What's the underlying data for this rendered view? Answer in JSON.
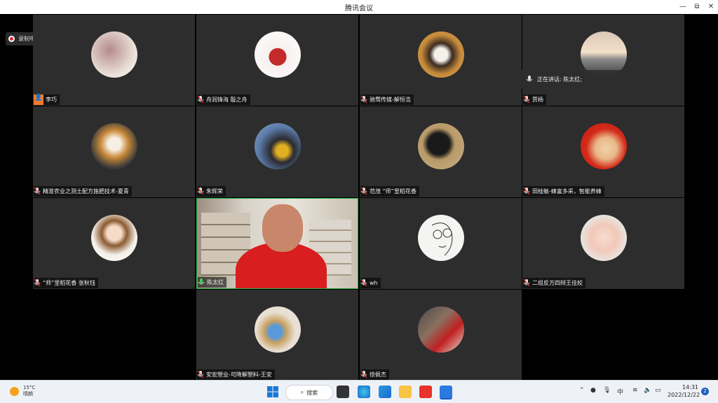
{
  "window": {
    "title": "腾讯会议",
    "minimize": "—",
    "restore": "⧉",
    "close": "✕"
  },
  "recording": {
    "label": "录制中"
  },
  "speaking": {
    "label": "正在讲话: 陈太红;"
  },
  "participants": [
    {
      "name": "李巧"
    },
    {
      "name": "舟润锋海 殷之舟"
    },
    {
      "name": "驰骛传媒-解恒浩"
    },
    {
      "name": "贾杨"
    },
    {
      "name": "精准农业之测土配方施肥技术-夏青"
    },
    {
      "name": "朱辉荣"
    },
    {
      "name": "范茂 “师”里稻花香"
    },
    {
      "name": "田桂敏-蜂富多采，智能养蜂"
    },
    {
      "name": "“师”里稻花香 张秋钰"
    },
    {
      "name": "陈太红"
    },
    {
      "name": "wh"
    },
    {
      "name": "二组反方四辩王佳姣"
    },
    {
      "name": "安宏塑业-可降解塑料-王安"
    },
    {
      "name": "徐佩杰"
    }
  ],
  "taskbar": {
    "weather_temp": "15°C",
    "weather_desc": "晴朗",
    "search_label": "搜索",
    "ime": "中",
    "time": "14:31",
    "date": "2022/12/22",
    "notification_count": "2"
  }
}
